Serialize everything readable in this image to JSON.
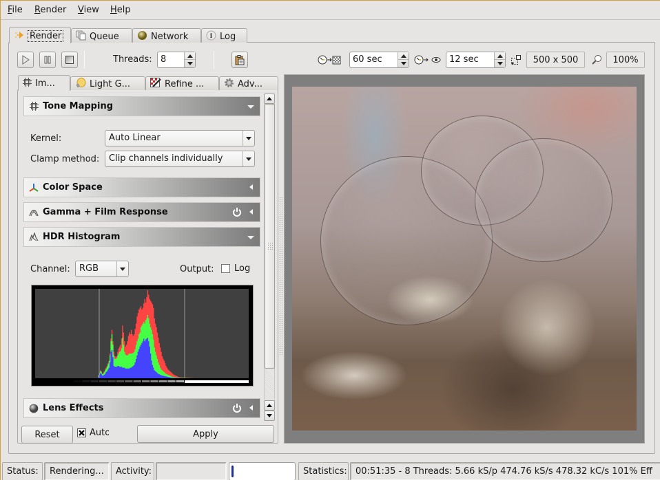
{
  "menu": [
    {
      "label": "File",
      "mnemonic": "F",
      "rest": "ile"
    },
    {
      "label": "Render",
      "mnemonic": "R",
      "rest": "ender"
    },
    {
      "label": "View",
      "mnemonic": "V",
      "rest": "iew"
    },
    {
      "label": "Help",
      "mnemonic": "H",
      "rest": "elp"
    }
  ],
  "main_tabs": [
    {
      "label": "Render",
      "icon": "render-icon",
      "active": true
    },
    {
      "label": "Queue",
      "icon": "queue-icon",
      "active": false
    },
    {
      "label": "Network",
      "icon": "network-globe-icon",
      "active": false
    },
    {
      "label": "Log",
      "icon": "info-icon",
      "active": false
    }
  ],
  "toolbar": {
    "threads_label": "Threads:",
    "threads_value": "8",
    "halt_time_value": "60 sec",
    "refresh_value": "12 sec",
    "resolution": "500 x 500",
    "zoom": "100%"
  },
  "sub_tabs": [
    {
      "label": "Im...",
      "icon": "imaging-icon",
      "active": true
    },
    {
      "label": "Light G...",
      "icon": "light-groups-icon",
      "active": false
    },
    {
      "label": "Refine ...",
      "icon": "refine-icon",
      "active": false
    },
    {
      "label": "Adv...",
      "icon": "gear-icon",
      "active": false
    }
  ],
  "sections": {
    "tone_mapping": {
      "title": "Tone Mapping",
      "expanded": true
    },
    "color_space": {
      "title": "Color Space",
      "expanded": false
    },
    "gamma": {
      "title": "Gamma + Film Response",
      "expanded": false,
      "power": true
    },
    "histogram": {
      "title": "HDR Histogram",
      "expanded": true
    },
    "lens": {
      "title": "Lens Effects",
      "expanded": false,
      "power": true
    }
  },
  "tone_mapping": {
    "kernel_label": "Kernel:",
    "kernel_value": "Auto Linear",
    "clamp_label": "Clamp method:",
    "clamp_value": "Clip channels individually"
  },
  "histogram": {
    "channel_label": "Channel:",
    "channel_value": "RGB",
    "output_label": "Output:",
    "log_label": "Log",
    "log_checked": false,
    "colors": {
      "red": "#ff4444",
      "green": "#44ff44",
      "blue": "#4444ff",
      "bg": "#404040"
    },
    "red": [
      0,
      0,
      0,
      0,
      0,
      0,
      0,
      0,
      0,
      0,
      0,
      0,
      0,
      0,
      0,
      0,
      0,
      0,
      0,
      0,
      0,
      0,
      0,
      0,
      0,
      0,
      0,
      0,
      0,
      0,
      0,
      0,
      0,
      0,
      0,
      0,
      0,
      0,
      0,
      0,
      0,
      0,
      0,
      0,
      0,
      0,
      0,
      0,
      0,
      0,
      0,
      0,
      0,
      0,
      0,
      0,
      0,
      0,
      0,
      0,
      0,
      0,
      0,
      0,
      0,
      0.03,
      0.06,
      0.09,
      0.08,
      0.05,
      0.06,
      0.08,
      0.1,
      0.12,
      0.14,
      0.17,
      0.2,
      0.28,
      0.45,
      0.55,
      0.42,
      0.3,
      0.25,
      0.24,
      0.25,
      0.3,
      0.34,
      0.36,
      0.38,
      0.45,
      0.6,
      0.52,
      0.42,
      0.36,
      0.38,
      0.42,
      0.48,
      0.52,
      0.5,
      0.55,
      0.5,
      0.48,
      0.5,
      0.56,
      0.62,
      0.7,
      0.74,
      0.78,
      0.8,
      0.82,
      0.78,
      0.8,
      0.85,
      0.9,
      0.86,
      0.92,
      1.0,
      0.95,
      0.9,
      0.88,
      0.86,
      0.84,
      0.8,
      0.68,
      0.62,
      0.58,
      0.52,
      0.46,
      0.4,
      0.35,
      0.3,
      0.25,
      0.22,
      0.2,
      0.17,
      0.14,
      0.12,
      0.1,
      0.09,
      0.08,
      0.07,
      0.06,
      0.05,
      0.04,
      0.035,
      0.03,
      0.025,
      0.02,
      0.015,
      0.012,
      0.01,
      0.008,
      0.007,
      0.006,
      0.005,
      0.005,
      0.004,
      0.004,
      0.003,
      0.003,
      0.002,
      0.002,
      0.002,
      0.001,
      0.001,
      0,
      0,
      0,
      0,
      0,
      0,
      0,
      0,
      0,
      0,
      0,
      0,
      0,
      0,
      0,
      0,
      0,
      0,
      0,
      0,
      0,
      0,
      0,
      0,
      0,
      0,
      0,
      0,
      0,
      0,
      0,
      0,
      0,
      0,
      0,
      0,
      0,
      0,
      0,
      0,
      0,
      0,
      0,
      0,
      0,
      0,
      0,
      0,
      0,
      0,
      0,
      0,
      0,
      0,
      0,
      0
    ],
    "green": [
      0,
      0,
      0,
      0,
      0,
      0,
      0,
      0,
      0,
      0,
      0,
      0,
      0,
      0,
      0,
      0,
      0,
      0,
      0,
      0,
      0,
      0,
      0,
      0,
      0,
      0,
      0,
      0,
      0,
      0,
      0,
      0,
      0,
      0,
      0,
      0,
      0,
      0,
      0,
      0,
      0,
      0,
      0,
      0,
      0,
      0,
      0,
      0,
      0,
      0,
      0,
      0,
      0,
      0,
      0,
      0,
      0,
      0,
      0,
      0,
      0,
      0,
      0,
      0,
      0,
      0.03,
      0.06,
      0.08,
      0.07,
      0.05,
      0.05,
      0.07,
      0.09,
      0.11,
      0.13,
      0.16,
      0.19,
      0.26,
      0.42,
      0.5,
      0.38,
      0.26,
      0.22,
      0.22,
      0.23,
      0.26,
      0.28,
      0.3,
      0.31,
      0.34,
      0.46,
      0.38,
      0.3,
      0.27,
      0.26,
      0.26,
      0.27,
      0.28,
      0.28,
      0.28,
      0.28,
      0.29,
      0.3,
      0.33,
      0.38,
      0.42,
      0.45,
      0.5,
      0.52,
      0.58,
      0.6,
      0.62,
      0.64,
      0.62,
      0.66,
      0.68,
      0.72,
      0.68,
      0.62,
      0.58,
      0.55,
      0.5,
      0.44,
      0.35,
      0.3,
      0.26,
      0.22,
      0.18,
      0.15,
      0.12,
      0.1,
      0.09,
      0.08,
      0.07,
      0.06,
      0.05,
      0.045,
      0.04,
      0.035,
      0.03,
      0.025,
      0.02,
      0.018,
      0.015,
      0.012,
      0.01,
      0.008,
      0.007,
      0.006,
      0.005,
      0.005,
      0.004,
      0.004,
      0.003,
      0.003,
      0.002,
      0.002,
      0.002,
      0.001,
      0.001,
      0.001,
      0,
      0,
      0,
      0,
      0,
      0,
      0,
      0,
      0,
      0,
      0,
      0,
      0,
      0,
      0,
      0,
      0,
      0,
      0,
      0,
      0,
      0,
      0,
      0,
      0,
      0,
      0,
      0,
      0,
      0,
      0,
      0,
      0,
      0,
      0,
      0,
      0,
      0,
      0,
      0,
      0,
      0,
      0,
      0,
      0,
      0,
      0,
      0,
      0,
      0,
      0,
      0,
      0,
      0,
      0,
      0
    ],
    "blue": [
      0,
      0,
      0,
      0,
      0,
      0,
      0,
      0,
      0,
      0,
      0,
      0,
      0,
      0,
      0,
      0,
      0,
      0,
      0,
      0,
      0,
      0,
      0,
      0,
      0,
      0,
      0,
      0,
      0,
      0,
      0,
      0,
      0,
      0,
      0,
      0,
      0,
      0,
      0,
      0,
      0,
      0,
      0,
      0,
      0,
      0,
      0,
      0,
      0,
      0,
      0,
      0,
      0,
      0,
      0,
      0,
      0,
      0,
      0,
      0,
      0,
      0,
      0,
      0,
      0,
      0.02,
      0.04,
      0.06,
      0.05,
      0.03,
      0.03,
      0.04,
      0.05,
      0.07,
      0.08,
      0.1,
      0.12,
      0.18,
      0.3,
      0.32,
      0.24,
      0.14,
      0.13,
      0.13,
      0.13,
      0.14,
      0.14,
      0.13,
      0.13,
      0.13,
      0.12,
      0.12,
      0.12,
      0.11,
      0.11,
      0.11,
      0.11,
      0.11,
      0.12,
      0.12,
      0.13,
      0.14,
      0.15,
      0.18,
      0.22,
      0.26,
      0.3,
      0.33,
      0.36,
      0.38,
      0.4,
      0.42,
      0.45,
      0.42,
      0.44,
      0.45,
      0.46,
      0.42,
      0.36,
      0.28,
      0.2,
      0.15,
      0.12,
      0.09,
      0.08,
      0.07,
      0.06,
      0.05,
      0.045,
      0.04,
      0.035,
      0.03,
      0.028,
      0.025,
      0.022,
      0.02,
      0.018,
      0.015,
      0.012,
      0.01,
      0.008,
      0.007,
      0.006,
      0.005,
      0.004,
      0.004,
      0.003,
      0.003,
      0.002,
      0.002,
      0.002,
      0.001,
      0.001,
      0.001,
      0,
      0,
      0,
      0,
      0,
      0,
      0,
      0,
      0,
      0,
      0,
      0,
      0,
      0,
      0,
      0,
      0,
      0,
      0,
      0,
      0,
      0,
      0,
      0,
      0,
      0,
      0,
      0,
      0,
      0,
      0,
      0,
      0,
      0,
      0,
      0,
      0,
      0,
      0,
      0,
      0,
      0,
      0,
      0,
      0,
      0,
      0,
      0,
      0,
      0,
      0,
      0,
      0,
      0,
      0,
      0,
      0,
      0,
      0,
      0,
      0,
      0,
      0,
      0
    ]
  },
  "bottom": {
    "reset_label": "Reset",
    "auto_label": "Auto",
    "auto_checked": true,
    "apply_label": "Apply"
  },
  "status": {
    "status_label": "Status:",
    "status_value": "Rendering...",
    "activity_label": "Activity:",
    "activity_value": "",
    "progress": 0.03,
    "statistics_label": "Statistics:",
    "statistics_value": "00:51:35 - 8 Threads: 5.66 kS/p 474.76 kS/s 478.32 kC/s 101% Eff"
  }
}
